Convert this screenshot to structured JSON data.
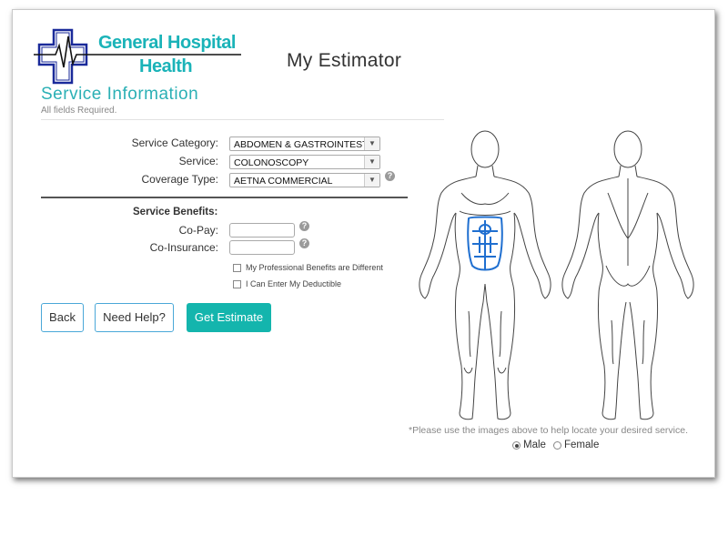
{
  "brand": {
    "line1": "General Hospital",
    "line2": "Health",
    "color": "#1ab3b8"
  },
  "page_title": "My Estimator",
  "section": {
    "title": "Service Information",
    "subtitle": "All fields Required."
  },
  "form": {
    "category_label": "Service Category:",
    "category_value": "ABDOMEN & GASTROINTEST",
    "service_label": "Service:",
    "service_value": "COLONOSCOPY",
    "coverage_label": "Coverage Type:",
    "coverage_value": "AETNA COMMERCIAL",
    "benefits_heading": "Service Benefits:",
    "copay_label": "Co-Pay:",
    "copay_value": "",
    "coins_label": "Co-Insurance:",
    "coins_value": "",
    "check_professional": "My Professional Benefits are Different",
    "check_deductible": "I Can Enter My Deductible"
  },
  "buttons": {
    "back": "Back",
    "help": "Need Help?",
    "estimate": "Get Estimate"
  },
  "help_glyph": "?",
  "body_note": "*Please use the images above to help locate your desired service.",
  "gender": {
    "male": "Male",
    "female": "Female",
    "selected": "Male"
  },
  "colors": {
    "accent": "#14b5ad",
    "highlight": "#1f6fd0",
    "button_border": "#4aa8d8"
  }
}
